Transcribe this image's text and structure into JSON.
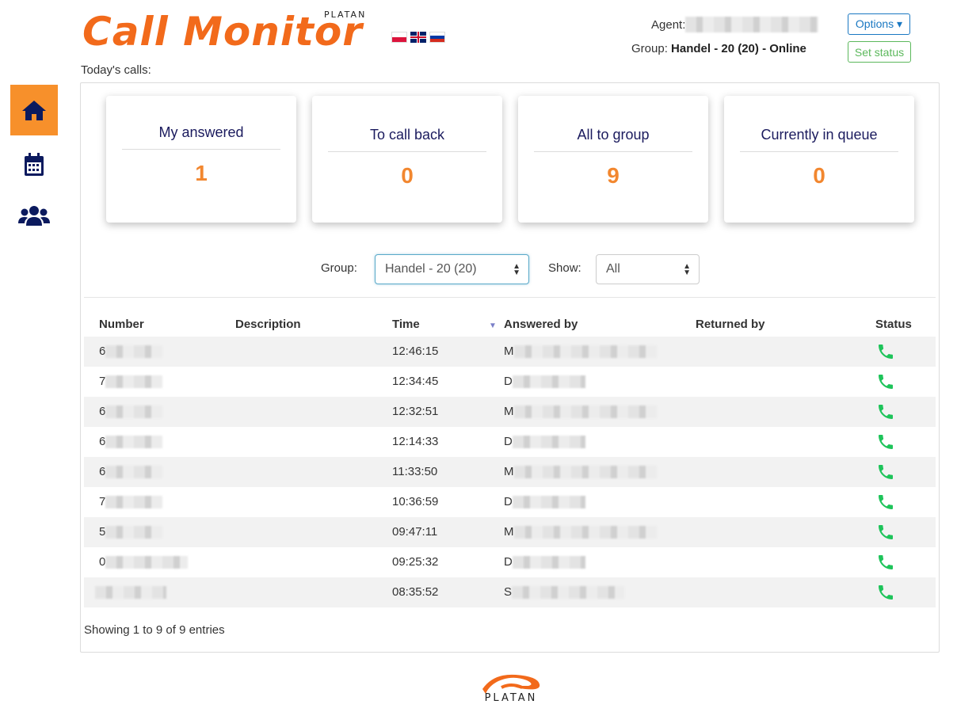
{
  "header": {
    "brand_title": "Call Monitor",
    "brand_sub": "PLATAN",
    "agent_label": "Agent:",
    "group_label": "Group:",
    "group_value": "Handel - 20 (20) - Online",
    "options_label": "Options",
    "set_status_label": "Set status",
    "flags": [
      "pl-flag-icon",
      "gb-flag-icon",
      "ru-flag-icon"
    ]
  },
  "today_label": "Today's calls:",
  "sidebar": {
    "items": [
      {
        "icon": "home-icon",
        "active": true
      },
      {
        "icon": "calendar-icon",
        "active": false
      },
      {
        "icon": "users-icon",
        "active": false
      }
    ]
  },
  "cards": [
    {
      "title": "My answered",
      "value": "1"
    },
    {
      "title": "To call back",
      "value": "0"
    },
    {
      "title": "All to group",
      "value": "9"
    },
    {
      "title": "Currently in queue",
      "value": "0"
    }
  ],
  "filters": {
    "group_label": "Group:",
    "group_value": "Handel - 20 (20)",
    "show_label": "Show:",
    "show_value": "All"
  },
  "table": {
    "columns": [
      "Number",
      "Description",
      "Time",
      "Answered by",
      "Returned by",
      "Status"
    ],
    "rows": [
      {
        "number": "6",
        "time": "12:46:15",
        "answered_by": "M",
        "status": "answered"
      },
      {
        "number": "7",
        "time": "12:34:45",
        "answered_by": "D",
        "status": "answered"
      },
      {
        "number": "6",
        "time": "12:32:51",
        "answered_by": "M",
        "status": "answered"
      },
      {
        "number": "6",
        "time": "12:14:33",
        "answered_by": "D",
        "status": "answered"
      },
      {
        "number": "6",
        "time": "11:33:50",
        "answered_by": "M",
        "status": "answered"
      },
      {
        "number": "7",
        "time": "10:36:59",
        "answered_by": "D",
        "status": "answered"
      },
      {
        "number": "5",
        "time": "09:47:11",
        "answered_by": "M",
        "status": "answered"
      },
      {
        "number": "0",
        "time": "09:25:32",
        "answered_by": "D",
        "status": "answered"
      },
      {
        "number": "",
        "time": "08:35:52",
        "answered_by": "S",
        "status": "answered"
      }
    ],
    "info": "Showing 1 to 9 of 9 entries"
  },
  "footer": {
    "logo_text": "PLATAN"
  },
  "colors": {
    "brand": "#f26a1b",
    "accent": "#f7902b",
    "nav": "#0b1a5e",
    "phone": "#1ec45a"
  }
}
